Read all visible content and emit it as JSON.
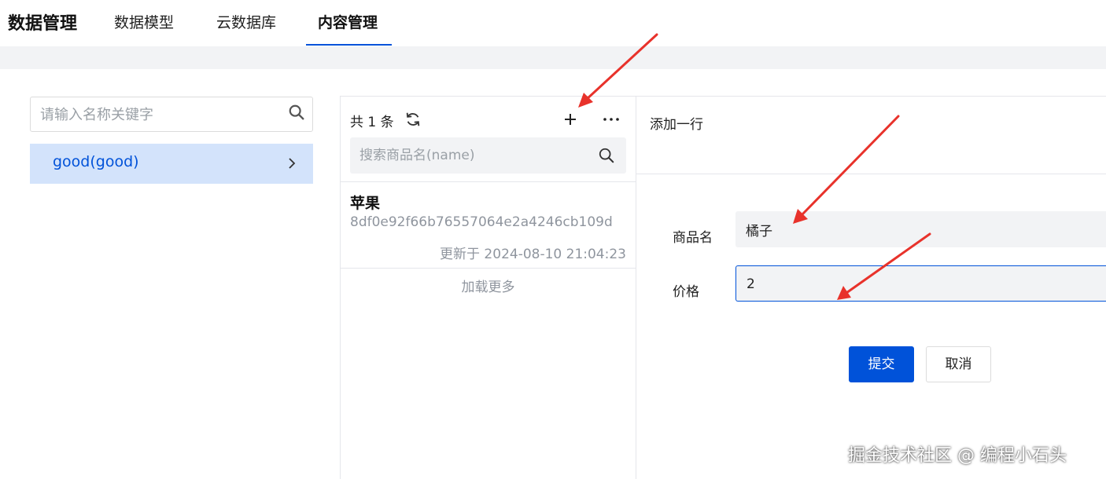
{
  "header": {
    "app_title": "数据管理",
    "tabs": [
      {
        "label": "数据模型",
        "active": false
      },
      {
        "label": "云数据库",
        "active": false
      },
      {
        "label": "内容管理",
        "active": true
      }
    ]
  },
  "sidebar": {
    "search_placeholder": "请输入名称关键字",
    "models": [
      {
        "label": "good(good)",
        "selected": true
      }
    ]
  },
  "list": {
    "count_text": "共 1 条",
    "search_placeholder": "搜索商品名(name)",
    "records": [
      {
        "name": "苹果",
        "id": "8df0e92f66b76557064e2a4246cb109d",
        "updated": "更新于 2024-08-10 21:04:23"
      }
    ],
    "load_more": "加载更多"
  },
  "form": {
    "title": "添加一行",
    "fields": [
      {
        "label": "商品名",
        "value": "橘子"
      },
      {
        "label": "价格",
        "value": "2"
      }
    ],
    "submit_label": "提交",
    "cancel_label": "取消"
  },
  "watermark": "掘金技术社区 @ 编程小石头",
  "colors": {
    "accent": "#0052d9",
    "selected_bg": "#d3e3fb",
    "annotation_arrow": "#e8322b"
  },
  "icons": [
    "search-icon",
    "chevron-right-icon",
    "refresh-icon",
    "plus-icon",
    "more-icon"
  ]
}
